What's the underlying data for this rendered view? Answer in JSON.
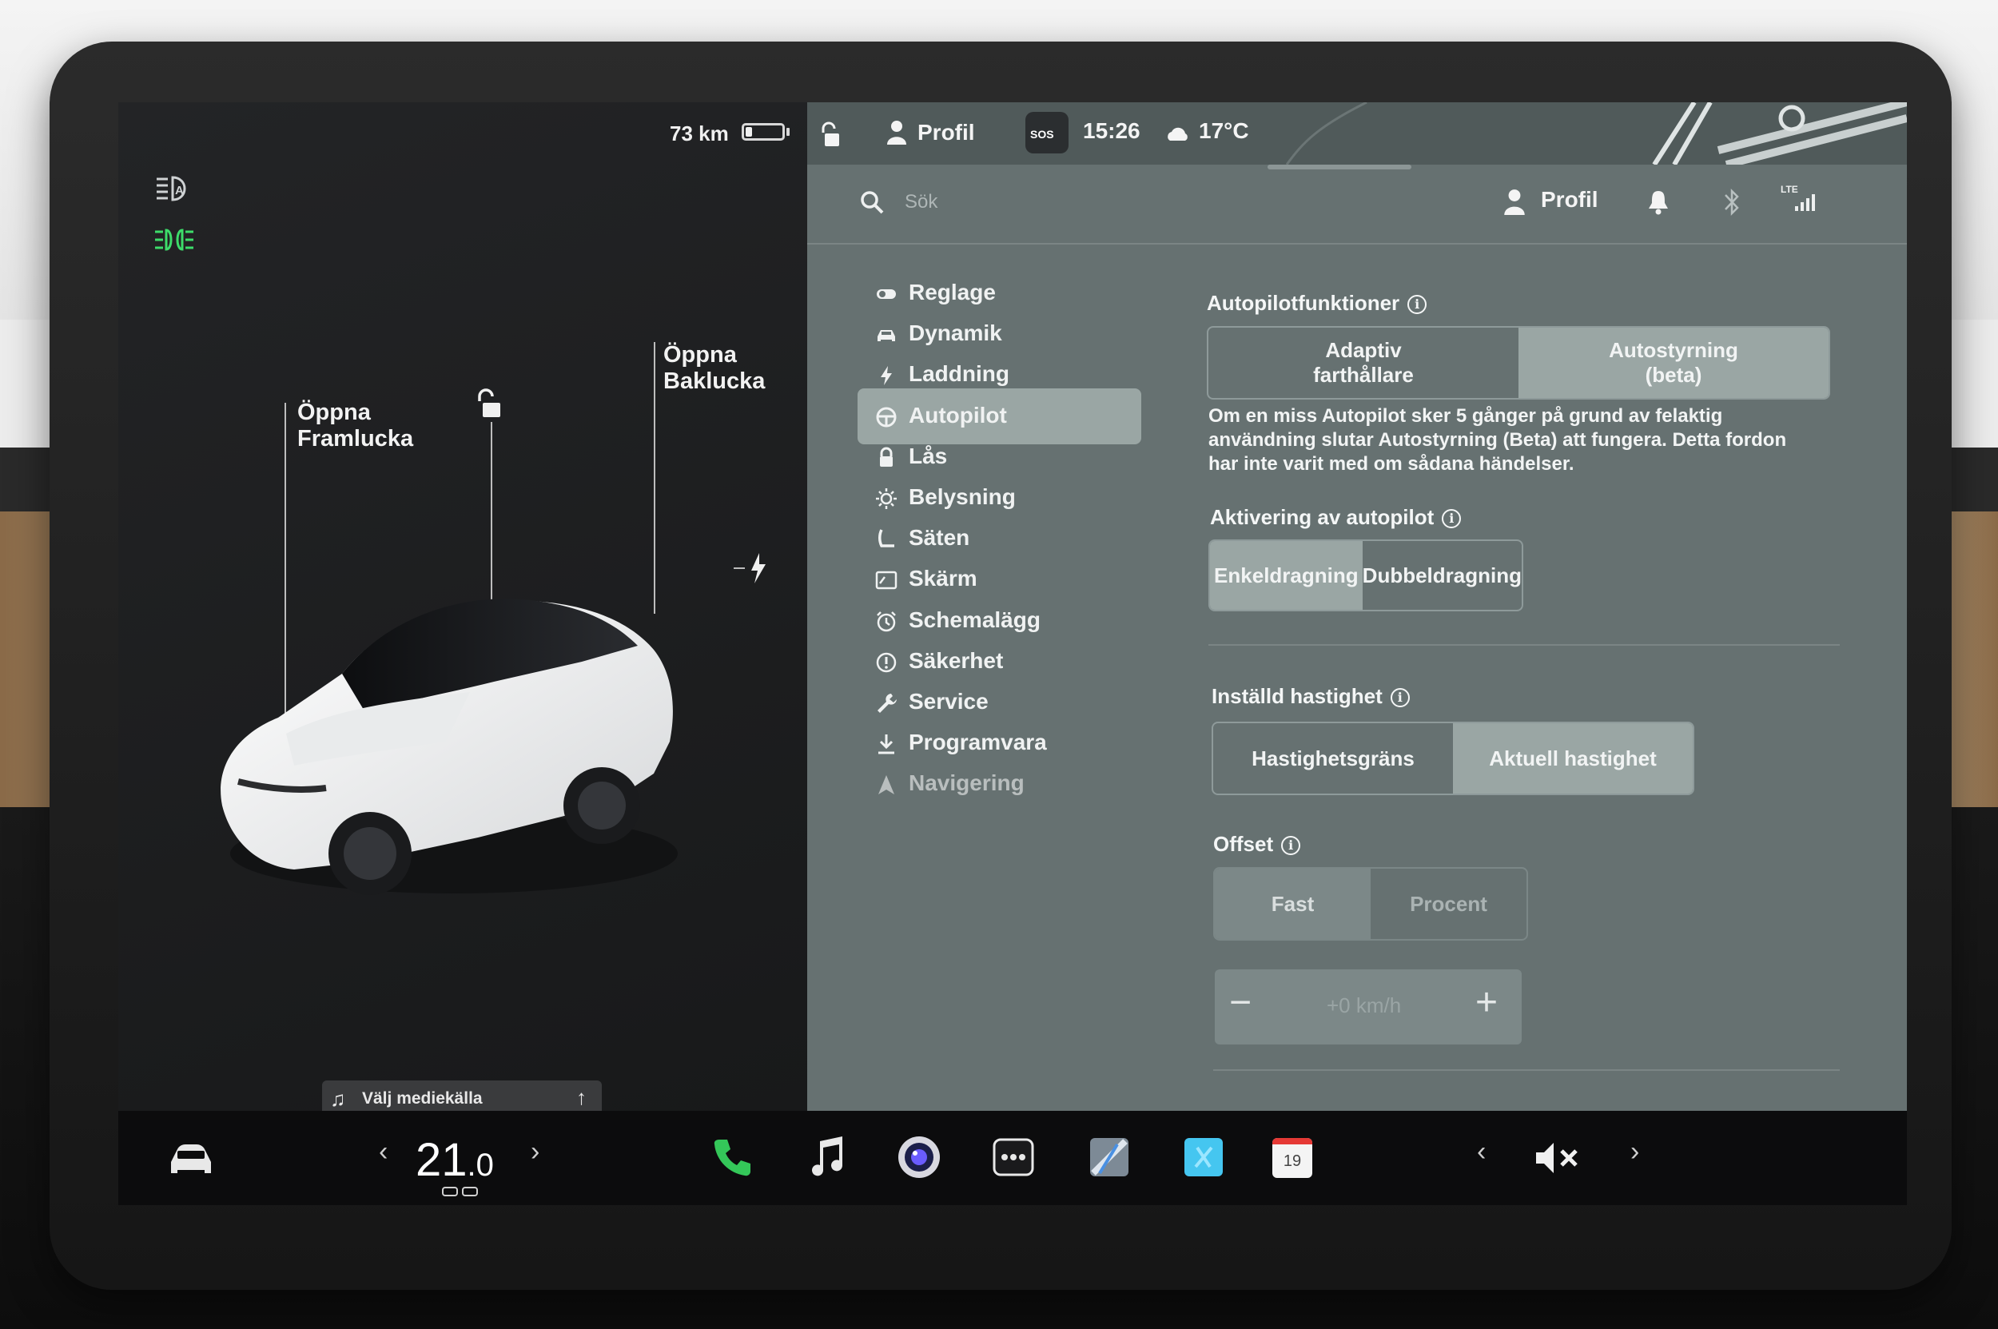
{
  "status_bar": {
    "range": "73 km",
    "battery_level": 0.18,
    "profile_label": "Profil",
    "sos_label": "SOS",
    "time": "15:26",
    "temperature": "17°C"
  },
  "left_panel": {
    "callouts": {
      "frunk_line1": "Öppna",
      "frunk_line2": "Framlucka",
      "trunk_line1": "Öppna",
      "trunk_line2": "Baklucka"
    },
    "media_source_label": "Välj mediekälla"
  },
  "top_bar": {
    "search_placeholder": "Sök",
    "profile_label": "Profil",
    "lte_label": "LTE"
  },
  "settings_menu": {
    "items": [
      {
        "label": "Reglage",
        "icon": "toggle-icon"
      },
      {
        "label": "Dynamik",
        "icon": "car-icon"
      },
      {
        "label": "Laddning",
        "icon": "bolt-icon"
      },
      {
        "label": "Autopilot",
        "icon": "steering-wheel-icon",
        "active": true
      },
      {
        "label": "Lås",
        "icon": "lock-icon"
      },
      {
        "label": "Belysning",
        "icon": "sun-icon"
      },
      {
        "label": "Säten",
        "icon": "seat-icon"
      },
      {
        "label": "Skärm",
        "icon": "display-icon"
      },
      {
        "label": "Schemalägg",
        "icon": "alarm-clock-icon"
      },
      {
        "label": "Säkerhet",
        "icon": "alert-circle-icon"
      },
      {
        "label": "Service",
        "icon": "wrench-icon"
      },
      {
        "label": "Programvara",
        "icon": "download-icon"
      },
      {
        "label": "Navigering",
        "icon": "navigation-icon"
      }
    ]
  },
  "autopilot": {
    "features_title": "Autopilotfunktioner",
    "features_options": {
      "opt1_line1": "Adaptiv",
      "opt1_line2": "farthållare",
      "opt2_line1": "Autostyrning",
      "opt2_line2": "(beta)",
      "selected": 2
    },
    "description_line1": "Om en miss Autopilot sker 5 gånger på grund av felaktig",
    "description_line2": "användning slutar Autostyrning (Beta) att fungera. Detta fordon",
    "description_line3": "har inte varit med om sådana händelser.",
    "activation_title": "Aktivering av autopilot",
    "activation_options": {
      "opt1": "Enkeldragning",
      "opt2": "Dubbeldragning",
      "selected": 1
    },
    "speed_title": "Inställd hastighet",
    "speed_options": {
      "opt1": "Hastighetsgräns",
      "opt2": "Aktuell hastighet",
      "selected": 2
    },
    "offset_title": "Offset",
    "offset_options": {
      "opt1": "Fast",
      "opt2": "Procent",
      "selected": 1
    },
    "offset_value": "+0 km/h",
    "minus_label": "−",
    "plus_label": "+"
  },
  "taskbar": {
    "temp_whole": "21",
    "temp_decimal": ".0",
    "calendar_day": "19",
    "prev_label": "‹",
    "next_label": "›",
    "media_prev": "‹",
    "media_next": "›"
  },
  "colors": {
    "settings_bg": "#667171",
    "selected_segment": "#9aa6a4",
    "headlight_green": "#3ddc6a"
  }
}
